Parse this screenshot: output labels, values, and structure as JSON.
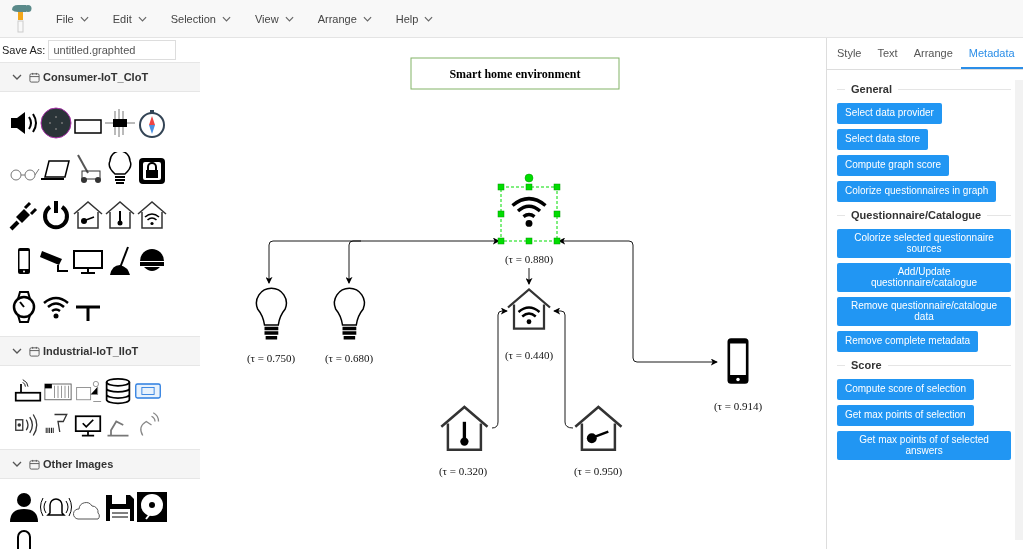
{
  "menu": {
    "items": [
      "File",
      "Edit",
      "Selection",
      "View",
      "Arrange",
      "Help"
    ]
  },
  "sidebar": {
    "save_as": {
      "label": "Save As:",
      "value": "untitled.graphted"
    },
    "sections": [
      {
        "title": "Consumer-IoT_CIoT",
        "expanded": true
      },
      {
        "title": "Industrial-IoT_IIoT",
        "expanded": true
      },
      {
        "title": "Other Images",
        "expanded": true
      }
    ]
  },
  "canvas": {
    "title": "Smart home environment",
    "nodes": [
      {
        "label": "(τ = 0.880)",
        "selected": true
      },
      {
        "label": "(τ = 0.750)",
        "selected": false
      },
      {
        "label": "(τ = 0.680)",
        "selected": false
      },
      {
        "label": "(τ = 0.440)",
        "selected": false
      },
      {
        "label": "(τ = 0.320)",
        "selected": false
      },
      {
        "label": "(τ = 0.950)",
        "selected": false
      },
      {
        "label": "(τ = 0.914)",
        "selected": false
      }
    ]
  },
  "format_panel": {
    "tabs": [
      {
        "label": "Style",
        "selected": false
      },
      {
        "label": "Text",
        "selected": false
      },
      {
        "label": "Arrange",
        "selected": false
      },
      {
        "label": "Metadata",
        "selected": true
      }
    ],
    "groups": [
      {
        "title": "General",
        "buttons": [
          "Select data provider",
          "Select data store",
          "Compute graph score",
          "Colorize questionnaires in graph"
        ]
      },
      {
        "title": "Questionnaire/Catalogue",
        "buttons": [
          "Colorize selected questionnaire sources",
          "Add/Update questionnaire/catalogue",
          "Remove questionnaire/catalogue data",
          "Remove complete metadata"
        ]
      },
      {
        "title": "Score",
        "buttons": [
          "Compute score of selection",
          "Get max points of selection",
          "Get max points of of selected answers"
        ]
      }
    ]
  }
}
